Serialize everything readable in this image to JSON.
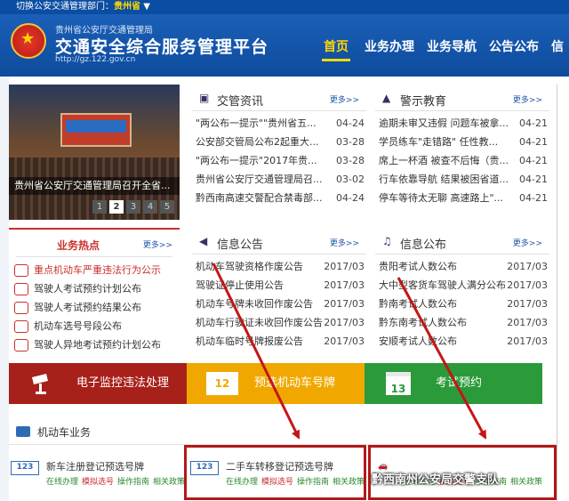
{
  "topbar": {
    "switch_label": "切换公安交通管理部门：",
    "province": "贵州省",
    "caret": "▼"
  },
  "header": {
    "org_name": "贵州省公安厅交通管理局",
    "title": "交通安全综合服务管理平台",
    "url": "http://gz.122.gov.cn"
  },
  "nav": {
    "items": [
      "首页",
      "业务办理",
      "业务导航",
      "公告公布",
      "信"
    ]
  },
  "slideshow": {
    "caption": "贵州省公安厅交通管理局召开全省...",
    "dots": [
      "1",
      "2",
      "3",
      "4",
      "5"
    ],
    "active_dot": 1
  },
  "panels": {
    "jiaoguan": {
      "title": "交管资讯",
      "more": "更多>>",
      "items": [
        {
          "text": "\"两公布一提示\"\"贵州省五...",
          "date": "04-24"
        },
        {
          "text": "公安部交管局公布2起重大...",
          "date": "03-28"
        },
        {
          "text": "\"两公布一提示\"2017年贵...",
          "date": "03-28"
        },
        {
          "text": "贵州省公安厅交通管理局召...",
          "date": "03-02"
        },
        {
          "text": "黔西南高速交警配合禁毒部...",
          "date": "04-24"
        }
      ]
    },
    "jingshi": {
      "title": "警示教育",
      "more": "更多>>",
      "items": [
        {
          "text": "逾期未审又违假 问题车被拿...",
          "date": "04-21"
        },
        {
          "text": "学员练车\"走错路\" 任性教...",
          "date": "04-21"
        },
        {
          "text": "席上一杯酒 被查不后悔（贵...",
          "date": "04-21"
        },
        {
          "text": "行车依靠导航 结果被困省道...",
          "date": "04-21"
        },
        {
          "text": "停车等待太无聊 高速路上\"...",
          "date": "04-21"
        }
      ]
    },
    "gonggao": {
      "title": "信息公告",
      "more": "更多>>",
      "items": [
        {
          "text": "机动车驾驶资格作废公告",
          "date": "2017/03"
        },
        {
          "text": "驾驶证停止使用公告",
          "date": "2017/03"
        },
        {
          "text": "机动车号牌未收回作废公告",
          "date": "2017/03"
        },
        {
          "text": "机动车行驶证未收回作废公告",
          "date": "2017/03"
        },
        {
          "text": "机动车临时号牌报废公告",
          "date": "2017/03"
        }
      ]
    },
    "gongbu": {
      "title": "信息公布",
      "more": "更多>>",
      "items": [
        {
          "text": "贵阳考试人数公布",
          "date": "2017/03"
        },
        {
          "text": "大中型客货车驾驶人满分公布",
          "date": "2017/03"
        },
        {
          "text": "黔南考试人数公布",
          "date": "2017/03"
        },
        {
          "text": "黔东南考试人数公布",
          "date": "2017/03"
        },
        {
          "text": "安顺考试人数公布",
          "date": "2017/03"
        }
      ]
    }
  },
  "hot": {
    "title": "业务热点",
    "more": "更多>>",
    "items": [
      "重点机动车严重违法行为公示",
      "驾驶人考试预约计划公布",
      "驾驶人考试预约结果公布",
      "机动车选号号段公布",
      "驾驶人异地考试预约计划公布"
    ]
  },
  "services": {
    "items": [
      "电子监控违法处理",
      "预选机动车号牌",
      "考试预约"
    ],
    "icon_texts": [
      "",
      "12",
      "13"
    ],
    "colors": [
      "#a8201a",
      "#f0a800",
      "#2a9a3a"
    ]
  },
  "vehicle": {
    "title": "机动车业务",
    "items": [
      {
        "name": "新车注册登记预选号牌",
        "icon": "123"
      },
      {
        "name": "二手车转移登记预选号牌",
        "icon": "123"
      },
      {
        "name": "",
        "icon": ""
      }
    ],
    "links": [
      "在线办理",
      "模拟选号",
      "操作指南",
      "相关政策"
    ]
  },
  "watermark": "黔西南州公安局交警支队",
  "colors": {
    "primary_blue": "#0b4da2",
    "accent_yellow": "#ffd800",
    "highlight_red": "#b31818"
  }
}
